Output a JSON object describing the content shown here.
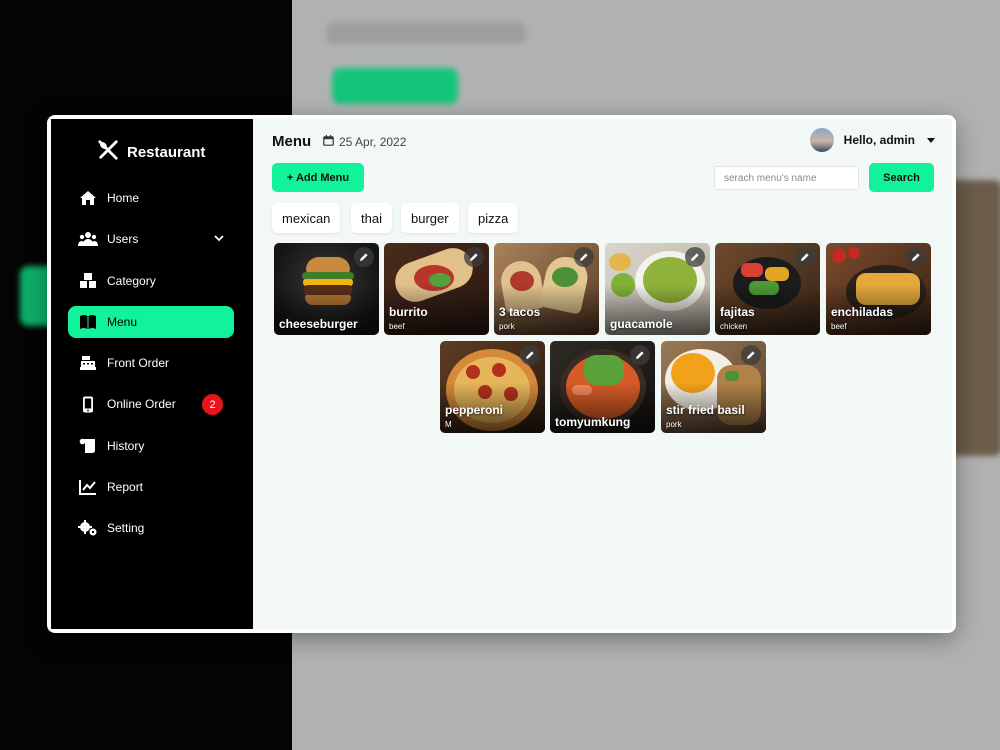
{
  "app": {
    "brand": "Restaurant"
  },
  "sidebar": {
    "items": [
      {
        "label": "Home",
        "icon": "home-icon"
      },
      {
        "label": "Users",
        "icon": "users-icon"
      },
      {
        "label": "Category",
        "icon": "category-icon"
      },
      {
        "label": "Menu",
        "icon": "menu-book-icon",
        "active": true
      },
      {
        "label": "Front Order",
        "icon": "cash-register-icon"
      },
      {
        "label": "Online Order",
        "icon": "mobile-icon",
        "badge": "2"
      },
      {
        "label": "History",
        "icon": "scroll-icon"
      },
      {
        "label": "Report",
        "icon": "chart-line-icon"
      },
      {
        "label": "Setting",
        "icon": "gears-icon"
      }
    ]
  },
  "header": {
    "title": "Menu",
    "date": "25 Apr, 2022",
    "greeting": "Hello, admin"
  },
  "toolbar": {
    "add_label": "+ Add Menu",
    "search_placeholder": "serach menu's name",
    "search_label": "Search"
  },
  "filters": [
    "mexican",
    "thai",
    "burger",
    "pizza"
  ],
  "menu_items": [
    {
      "name": "cheeseburger",
      "sub": ""
    },
    {
      "name": "burrito",
      "sub": "beef"
    },
    {
      "name": "3 tacos",
      "sub": "pork"
    },
    {
      "name": "guacamole",
      "sub": ""
    },
    {
      "name": "fajitas",
      "sub": "chicken"
    },
    {
      "name": "enchiladas",
      "sub": "beef"
    },
    {
      "name": "pepperoni",
      "sub": "M"
    },
    {
      "name": "tomyumkung",
      "sub": ""
    },
    {
      "name": "stir fried basil",
      "sub": "pork"
    }
  ],
  "colors": {
    "accent": "#12f29a",
    "badge": "#e8131b",
    "sidebar": "#000000",
    "content_bg": "#f2f8f5"
  }
}
